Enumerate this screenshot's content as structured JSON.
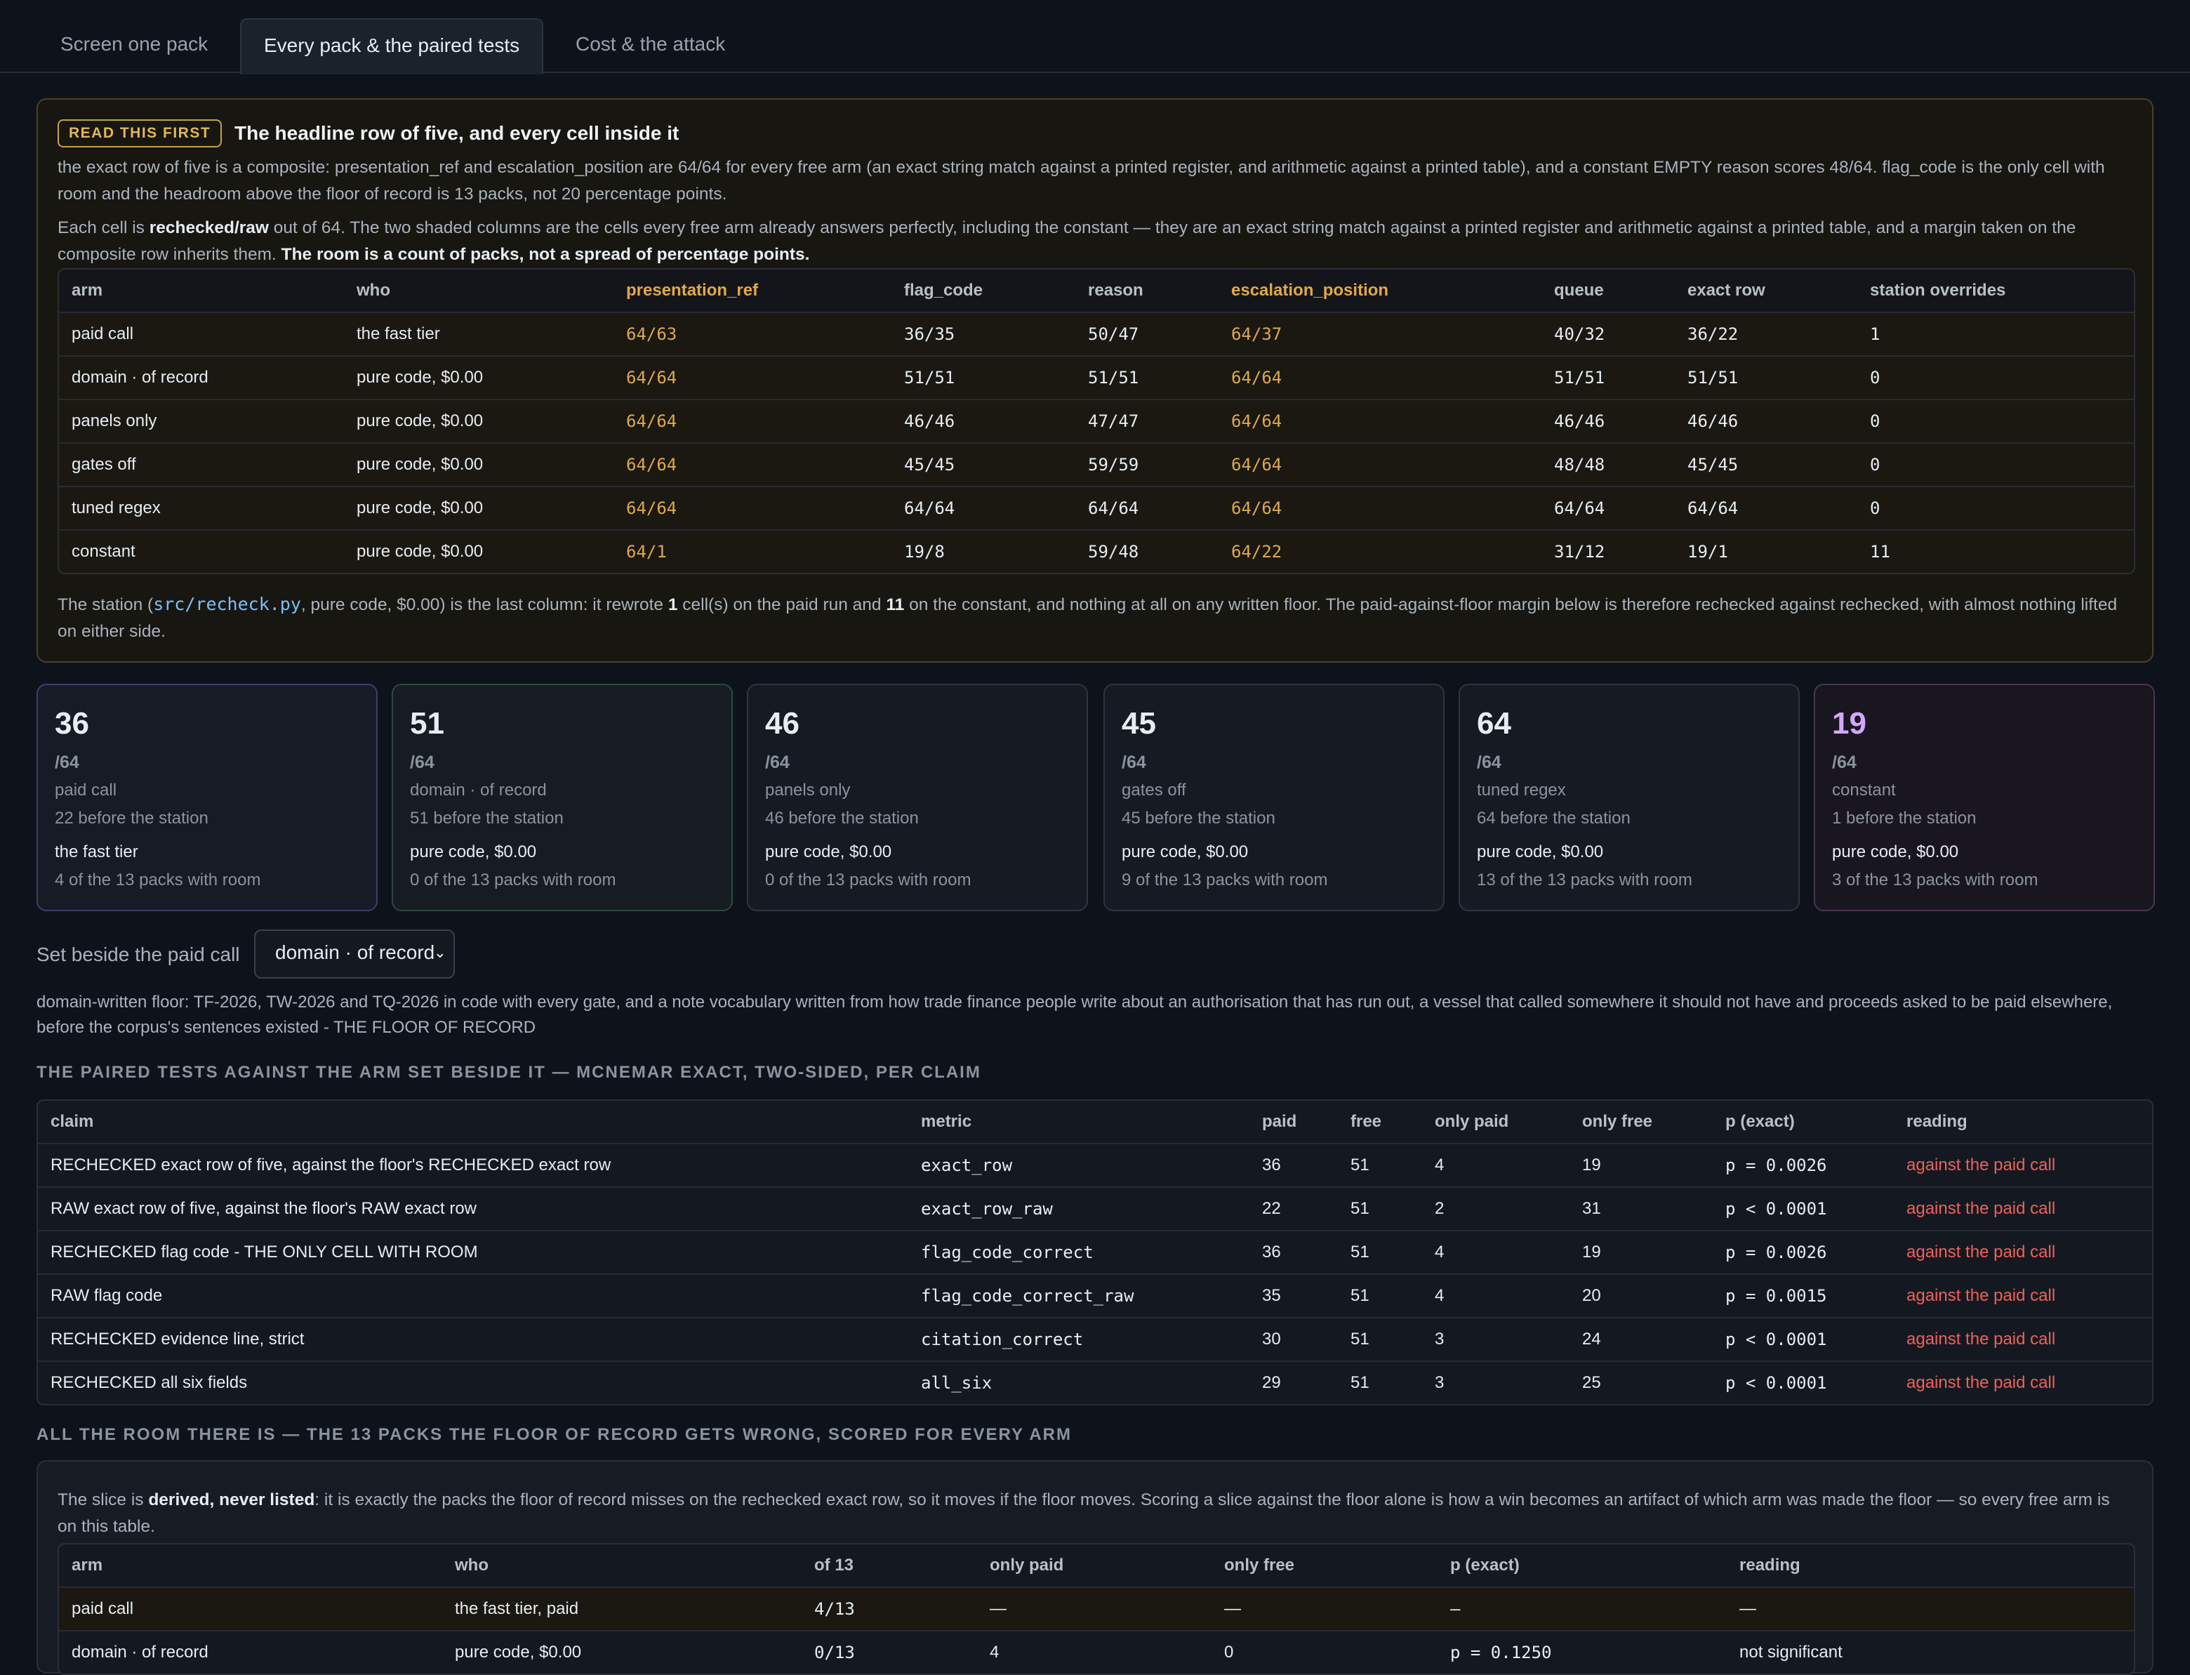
{
  "tabs": [
    {
      "label": "Screen one pack"
    },
    {
      "label": "Every pack & the paired tests"
    },
    {
      "label": "Cost & the attack"
    }
  ],
  "read_first": {
    "pill": "READ THIS FIRST",
    "title": "The headline row of five, and every cell inside it",
    "p1": "the exact row of five is a composite: presentation_ref and escalation_position are 64/64 for every free arm (an exact string match against a printed register, and arithmetic against a printed table), and a constant EMPTY reason scores 48/64. flag_code is the only cell with room and the headroom above the floor of record is 13 packs, not 20 percentage points.",
    "p2_a": "Each cell is ",
    "p2_b": "rechecked/raw",
    "p2_c": " out of 64. The two shaded columns are the cells every free arm already answers perfectly, including the constant — they are an exact string match against a printed register and arithmetic against a printed table, and a margin taken on the composite row inherits them. ",
    "p2_d": "The room is a count of packs, not a spread of percentage points.",
    "headers": [
      "arm",
      "who",
      "presentation_ref",
      "flag_code",
      "reason",
      "escalation_position",
      "queue",
      "exact row",
      "station overrides"
    ],
    "rows": [
      [
        "paid call",
        "the fast tier",
        "64/63",
        "36/35",
        "50/47",
        "64/37",
        "40/32",
        "36/22",
        "1"
      ],
      [
        "domain · of record",
        "pure code, $0.00",
        "64/64",
        "51/51",
        "51/51",
        "64/64",
        "51/51",
        "51/51",
        "0"
      ],
      [
        "panels only",
        "pure code, $0.00",
        "64/64",
        "46/46",
        "47/47",
        "64/64",
        "46/46",
        "46/46",
        "0"
      ],
      [
        "gates off",
        "pure code, $0.00",
        "64/64",
        "45/45",
        "59/59",
        "64/64",
        "48/48",
        "45/45",
        "0"
      ],
      [
        "tuned regex",
        "pure code, $0.00",
        "64/64",
        "64/64",
        "64/64",
        "64/64",
        "64/64",
        "64/64",
        "0"
      ],
      [
        "constant",
        "pure code, $0.00",
        "64/1",
        "19/8",
        "59/48",
        "64/22",
        "31/12",
        "19/1",
        "11"
      ]
    ],
    "p3_a": "The station (",
    "p3_code": "src/recheck.py",
    "p3_b": ", pure code, $0.00) is the last column: it rewrote ",
    "p3_n1": "1",
    "p3_c": " cell(s) on the paid run and ",
    "p3_n2": "11",
    "p3_d": " on the constant, and nothing at all on any written floor. The paid-against-floor margin below is therefore rechecked against rechecked, with almost nothing lifted on either side."
  },
  "cards": [
    {
      "big": "36",
      "of": "/64",
      "name": "paid call",
      "before": "22 before the station",
      "who": "the fast tier",
      "room": "4 of the 13 packs with room",
      "border": "#3b3f6e",
      "bg": "#161b26",
      "bigcolor": "#e6edf3"
    },
    {
      "big": "51",
      "of": "/64",
      "name": "domain · of record",
      "before": "51 before the station",
      "who": "pure code, $0.00",
      "room": "0 of the 13 packs with room",
      "border": "#2c4a3c",
      "bg": "#161c22",
      "bigcolor": "#e6edf3"
    },
    {
      "big": "46",
      "of": "/64",
      "name": "panels only",
      "before": "46 before the station",
      "who": "pure code, $0.00",
      "room": "0 of the 13 packs with room",
      "border": "#2e3440",
      "bg": "#161b23",
      "bigcolor": "#e6edf3"
    },
    {
      "big": "45",
      "of": "/64",
      "name": "gates off",
      "before": "45 before the station",
      "who": "pure code, $0.00",
      "room": "9 of the 13 packs with room",
      "border": "#2e3440",
      "bg": "#161b23",
      "bigcolor": "#e6edf3"
    },
    {
      "big": "64",
      "of": "/64",
      "name": "tuned regex",
      "before": "64 before the station",
      "who": "pure code, $0.00",
      "room": "13 of the 13 packs with room",
      "border": "#2e3440",
      "bg": "#161b23",
      "bigcolor": "#e6edf3"
    },
    {
      "big": "19",
      "of": "/64",
      "name": "constant",
      "before": "1 before the station",
      "who": "pure code, $0.00",
      "room": "3 of the 13 packs with room",
      "border": "#4a3550",
      "bg": "#1a1620",
      "bigcolor": "#d2a8ff"
    }
  ],
  "selector": {
    "label": "Set beside the paid call",
    "value": "domain · of record"
  },
  "floor_desc": "domain-written floor: TF-2026, TW-2026 and TQ-2026 in code with every gate, and a note vocabulary written from how trade finance people write about an authorisation that has run out, a vessel that called somewhere it should not have and proceeds asked to be paid elsewhere, before the corpus's sentences existed - THE FLOOR OF RECORD",
  "paired": {
    "title": "THE PAIRED TESTS AGAINST THE ARM SET BESIDE IT — MCNEMAR EXACT, TWO-SIDED, PER CLAIM",
    "headers": [
      "claim",
      "metric",
      "paid",
      "free",
      "only paid",
      "only free",
      "p (exact)",
      "reading"
    ],
    "rows": [
      [
        "RECHECKED exact row of five, against the floor's RECHECKED exact row",
        "exact_row",
        "36",
        "51",
        "4",
        "19",
        "p = 0.0026",
        "against the paid call"
      ],
      [
        "RAW exact row of five, against the floor's RAW exact row",
        "exact_row_raw",
        "22",
        "51",
        "2",
        "31",
        "p < 0.0001",
        "against the paid call"
      ],
      [
        "RECHECKED flag code - THE ONLY CELL WITH ROOM",
        "flag_code_correct",
        "36",
        "51",
        "4",
        "19",
        "p = 0.0026",
        "against the paid call"
      ],
      [
        "RAW flag code",
        "flag_code_correct_raw",
        "35",
        "51",
        "4",
        "20",
        "p = 0.0015",
        "against the paid call"
      ],
      [
        "RECHECKED evidence line, strict",
        "citation_correct",
        "30",
        "51",
        "3",
        "24",
        "p < 0.0001",
        "against the paid call"
      ],
      [
        "RECHECKED all six fields",
        "all_six",
        "29",
        "51",
        "3",
        "25",
        "p < 0.0001",
        "against the paid call"
      ]
    ]
  },
  "room": {
    "title": "ALL THE ROOM THERE IS — THE 13 PACKS THE FLOOR OF RECORD GETS WRONG, SCORED FOR EVERY ARM",
    "p_a": "The slice is ",
    "p_b": "derived, never listed",
    "p_c": ": it is exactly the packs the floor of record misses on the rechecked exact row, so it moves if the floor moves. Scoring a slice against the floor alone is how a win becomes an artifact of which arm was made the floor — so every free arm is on this table.",
    "headers": [
      "arm",
      "who",
      "of 13",
      "only paid",
      "only free",
      "p (exact)",
      "reading"
    ],
    "rows": [
      [
        "paid call",
        "the fast tier, paid",
        "4/13",
        "—",
        "—",
        "—",
        "—"
      ],
      [
        "domain · of record",
        "pure code, $0.00",
        "0/13",
        "4",
        "0",
        "p = 0.1250",
        "not significant"
      ]
    ]
  }
}
